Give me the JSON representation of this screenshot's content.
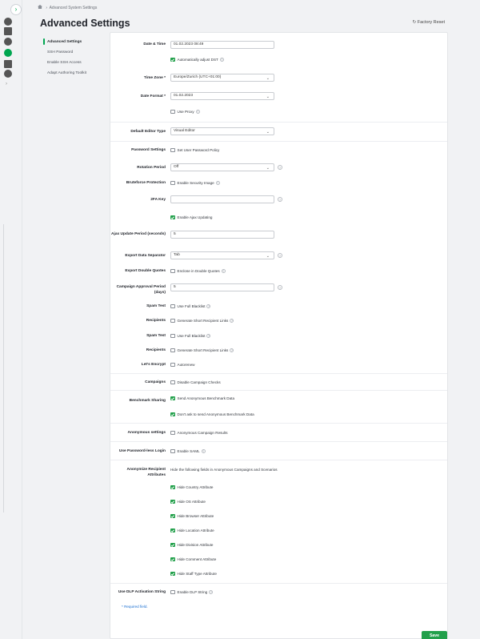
{
  "breadcrumb": {
    "label": "Advanced System Settings"
  },
  "page": {
    "title": "Advanced Settings",
    "factory_reset": "Factory Reset"
  },
  "sidenav": {
    "items": [
      {
        "label": "Advanced Settings",
        "active": true
      },
      {
        "label": "SSH Password",
        "active": false
      },
      {
        "label": "Enable SSH Access",
        "active": false
      },
      {
        "label": "Adapt Authoring Toolkit",
        "active": false
      }
    ]
  },
  "form": {
    "datetime": {
      "label": "Date & Time",
      "value": "01.02.2023 08:49"
    },
    "auto_dst": {
      "label": "Automatically adjust DST",
      "checked": true
    },
    "timezone": {
      "label": "Time Zone",
      "value": "Europe/Zurich (UTC+01:00)"
    },
    "date_format": {
      "label": "Date Format",
      "value": "01.02.2023"
    },
    "use_proxy": {
      "label": "Use Proxy",
      "checked": false
    },
    "editor_type": {
      "label": "Default Editor Type",
      "value": "Visual Editor"
    },
    "password_settings": {
      "label": "Password Settings",
      "option": "Set User Password Policy",
      "checked": false
    },
    "rotation_period": {
      "label": "Rotation Period",
      "value": "Off"
    },
    "bruteforce": {
      "label": "Bruteforce Protection",
      "option": "Enable Security Image",
      "checked": false
    },
    "twofa": {
      "label": "2FA Key",
      "value": ""
    },
    "ajax_updating": {
      "label": "Enable Ajax Updating",
      "checked": true
    },
    "ajax_period": {
      "label": "Ajax Update Period (seconds)",
      "value": "5"
    },
    "export_sep": {
      "label": "Export Data Separator",
      "value": "Tab"
    },
    "export_quotes": {
      "label": "Export Double Quotes",
      "option": "Enclose in Double Quotes",
      "checked": false
    },
    "campaign_approval": {
      "label": "Campaign Approval Period (days)",
      "value": "5"
    },
    "spam_test_1": {
      "label": "Spam Test",
      "option": "Use Full Blacklist",
      "checked": false
    },
    "recipients_1": {
      "label": "Recipients",
      "option": "Generate Short Recipient Links",
      "checked": false
    },
    "spam_test_2": {
      "label": "Spam Test",
      "option": "Use Full Blacklist",
      "checked": false
    },
    "recipients_2": {
      "label": "Recipients",
      "option": "Generate Short Recipient Links",
      "checked": false
    },
    "lets_encrypt": {
      "label": "Let's Encrypt",
      "option": "Autorenew",
      "checked": false
    },
    "campaigns": {
      "label": "Campaigns",
      "option": "Disable Campaign Checks",
      "checked": false
    },
    "benchmark": {
      "label": "Benchmark Sharing",
      "option1": "Send Anonymous Benchmark Data",
      "option2": "Don't ask to send Anonymous Benchmark Data"
    },
    "anonymous": {
      "label": "Anonymous settings",
      "option": "Anonymous Campaign Results",
      "checked": false
    },
    "passwordless": {
      "label": "Use Password-less Login",
      "option": "Enable SAML",
      "checked": false
    },
    "anonymize": {
      "label": "Anonymize Recipient Attributes",
      "description": "Hide the following fields in Anonymous Campaigns and Scenarios",
      "attrs": [
        "Hide Country Attribute",
        "Hide OS Attribute",
        "Hide Browser Attribute",
        "Hide Location Attribute",
        "Hide Division Attribute",
        "Hide Comment Attribute",
        "Hide Staff Type Attribute"
      ]
    },
    "dlp": {
      "label": "Use DLP Activation String",
      "option": "Enable DLP String",
      "checked": false
    }
  },
  "footer": {
    "required_note": "* Required field.",
    "save": "Save"
  },
  "colors": {
    "accent": "#22a04b",
    "link": "#1a6fd1"
  }
}
